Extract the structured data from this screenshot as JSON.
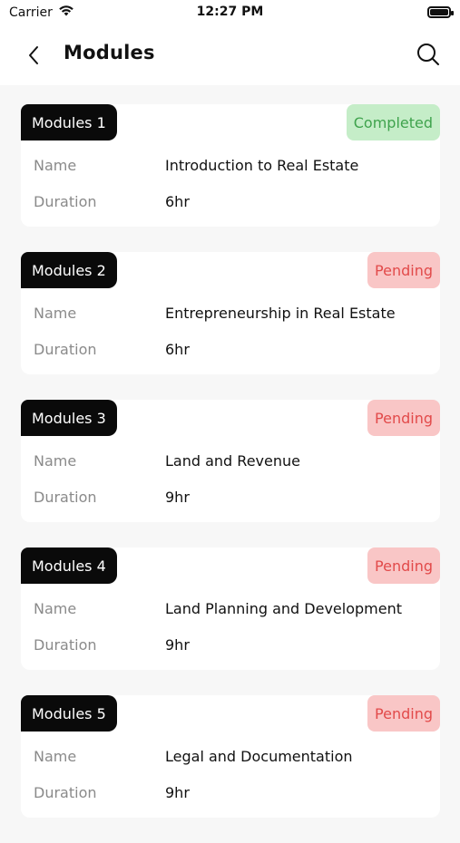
{
  "status_bar": {
    "carrier": "Carrier",
    "time": "12:27 PM"
  },
  "header": {
    "title": "Modules"
  },
  "labels": {
    "name": "Name",
    "duration": "Duration"
  },
  "colors": {
    "completed_bg": "#c5edc8",
    "completed_text": "#3fa34d",
    "pending_bg": "#f9c6c6",
    "pending_text": "#e24a4a",
    "tag_bg": "#0a0a0a"
  },
  "modules": [
    {
      "tag": "Modules 1",
      "status": "Completed",
      "name": "Introduction to Real Estate",
      "duration": "6hr"
    },
    {
      "tag": "Modules 2",
      "status": "Pending",
      "name": "Entrepreneurship in Real Estate",
      "duration": "6hr"
    },
    {
      "tag": "Modules 3",
      "status": "Pending",
      "name": "Land and Revenue",
      "duration": "9hr"
    },
    {
      "tag": "Modules 4",
      "status": "Pending",
      "name": "Land Planning and Development",
      "duration": "9hr"
    },
    {
      "tag": "Modules 5",
      "status": "Pending",
      "name": "Legal and Documentation",
      "duration": "9hr"
    }
  ]
}
